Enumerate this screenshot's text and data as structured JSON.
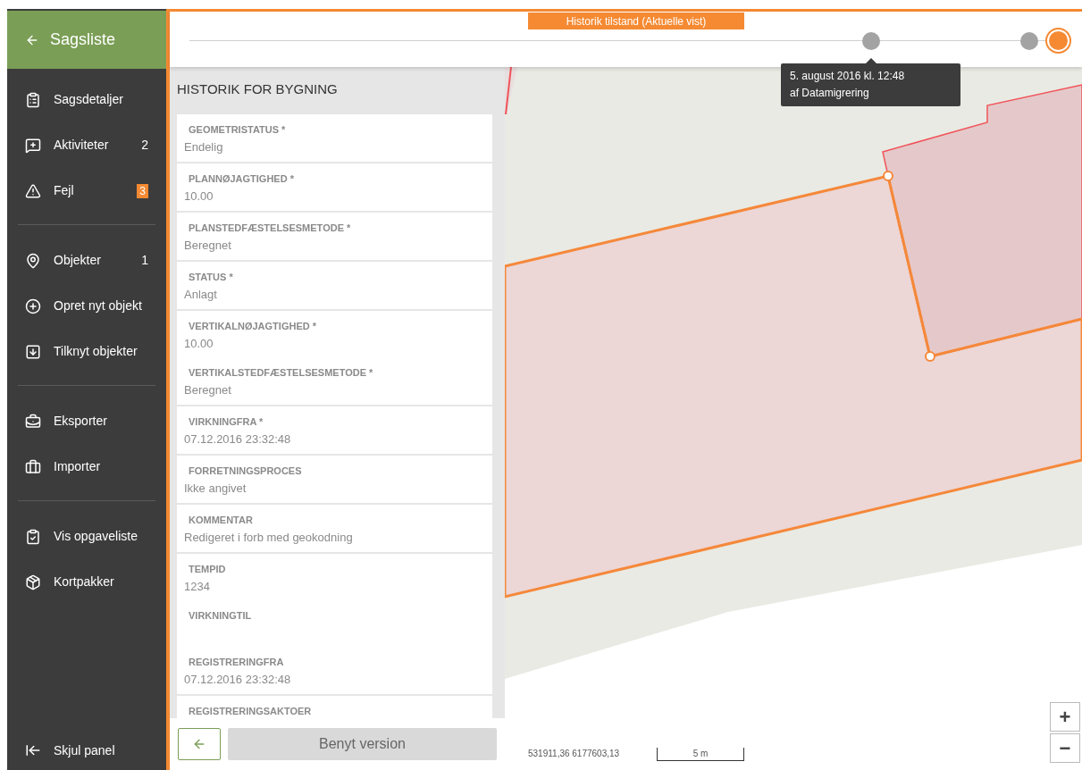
{
  "sidebar": {
    "back_title": "Sagsliste",
    "sections": [
      [
        {
          "label": "Sagsdetaljer",
          "kind": "plain"
        },
        {
          "label": "Aktiviteter",
          "kind": "count",
          "count": "2"
        },
        {
          "label": "Fejl",
          "kind": "badge",
          "count": "3"
        }
      ],
      [
        {
          "label": "Objekter",
          "kind": "count",
          "count": "1"
        },
        {
          "label": "Opret nyt objekt",
          "kind": "plain"
        },
        {
          "label": "Tilknyt objekter",
          "kind": "plain"
        }
      ],
      [
        {
          "label": "Eksporter",
          "kind": "plain"
        },
        {
          "label": "Importer",
          "kind": "plain"
        }
      ],
      [
        {
          "label": "Vis opgaveliste",
          "kind": "plain"
        },
        {
          "label": "Kortpakker",
          "kind": "plain"
        }
      ]
    ],
    "footer": "Skjul panel"
  },
  "timeline": {
    "title": "Historik tilstand (Aktuelle vist)",
    "points": [
      {
        "selected": false,
        "tooltip": [
          "5. august 2016 kl. 12:48",
          "af Datamigrering"
        ]
      },
      {
        "selected": false
      },
      {
        "selected": true
      }
    ]
  },
  "panel": {
    "title": "HISTORIK FOR BYGNING",
    "groups": [
      {
        "fields": [
          {
            "label": "GEOMETRISTATUS *",
            "value": "Endelig"
          }
        ]
      },
      {
        "fields": [
          {
            "label": "PLANNØJAGTIGHED *",
            "value": "10.00"
          }
        ]
      },
      {
        "fields": [
          {
            "label": "PLANSTEDFÆSTELSESMETODE *",
            "value": "Beregnet"
          }
        ]
      },
      {
        "fields": [
          {
            "label": "STATUS *",
            "value": "Anlagt"
          }
        ]
      },
      {
        "fields": [
          {
            "label": "VERTIKALNØJAGTIGHED *",
            "value": "10.00"
          },
          {
            "label": "VERTIKALSTEDFÆSTELSESMETODE *",
            "value": "Beregnet"
          }
        ]
      },
      {
        "fields": [
          {
            "label": "VIRKNINGFRA *",
            "value": "07.12.2016 23:32:48"
          }
        ]
      },
      {
        "fields": [
          {
            "label": "FORRETNINGSPROCES",
            "value": "Ikke angivet"
          }
        ]
      },
      {
        "fields": [
          {
            "label": "KOMMENTAR",
            "value": "Redigeret i forb med geokodning"
          }
        ]
      },
      {
        "fields": [
          {
            "label": "TEMPID",
            "value": "1234"
          },
          {
            "label": "VIRKNINGTIL"
          },
          {
            "label": "REGISTRERINGFRA",
            "value": "07.12.2016 23:32:48"
          }
        ]
      },
      {
        "fields": [
          {
            "label": "REGISTRERINGSAKTOER"
          }
        ]
      }
    ],
    "apply_button": "Benyt version"
  },
  "map": {
    "coordinates": "531911,36 6177603,13",
    "scale": "5 m",
    "zoom_in": "+",
    "zoom_out": "−"
  }
}
